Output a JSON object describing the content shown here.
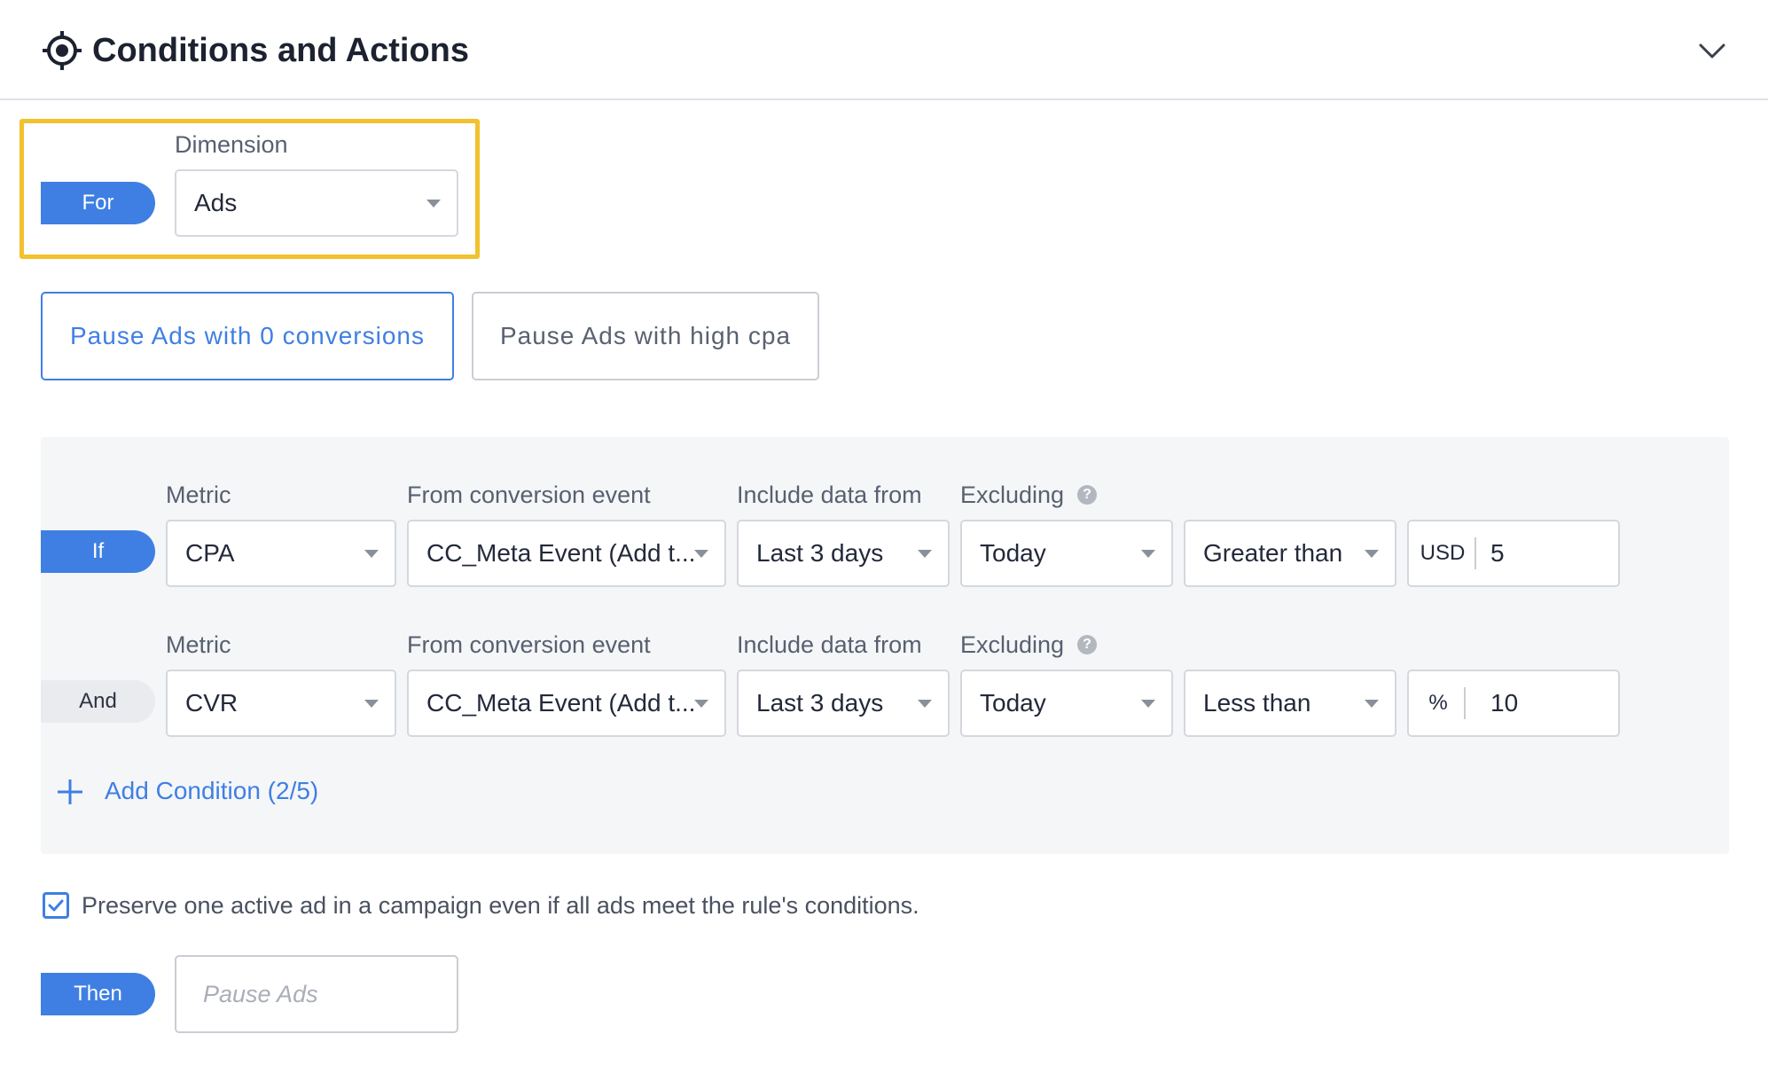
{
  "header": {
    "title": "Conditions and Actions"
  },
  "dimension": {
    "pill": "For",
    "label": "Dimension",
    "value": "Ads"
  },
  "templates": [
    {
      "label": "Pause Ads with 0 conversions",
      "active": true
    },
    {
      "label": "Pause Ads with high cpa",
      "active": false
    }
  ],
  "conditions": [
    {
      "pill": "If",
      "labels": {
        "metric": "Metric",
        "event": "From conversion event",
        "range": "Include data from",
        "excluding": "Excluding"
      },
      "metric": "CPA",
      "event": "CC_Meta Event (Add t...",
      "range": "Last 3 days",
      "excluding": "Today",
      "operator": "Greater than",
      "unit": "USD",
      "value": "5"
    },
    {
      "pill": "And",
      "labels": {
        "metric": "Metric",
        "event": "From conversion event",
        "range": "Include data from",
        "excluding": "Excluding"
      },
      "metric": "CVR",
      "event": "CC_Meta Event (Add t...",
      "range": "Last 3 days",
      "excluding": "Today",
      "operator": "Less than",
      "unit": "%",
      "value": "10"
    }
  ],
  "add_condition": {
    "label": "Add Condition (2/5)"
  },
  "preserve": {
    "label": "Preserve one active ad in a campaign even if all ads meet the rule's conditions.",
    "checked": true
  },
  "action": {
    "pill": "Then",
    "placeholder": "Pause Ads"
  },
  "help_glyph": "?",
  "colors": {
    "accent": "#3f7fe3",
    "highlight": "#f2c12e",
    "panel": "#f5f6f8"
  }
}
